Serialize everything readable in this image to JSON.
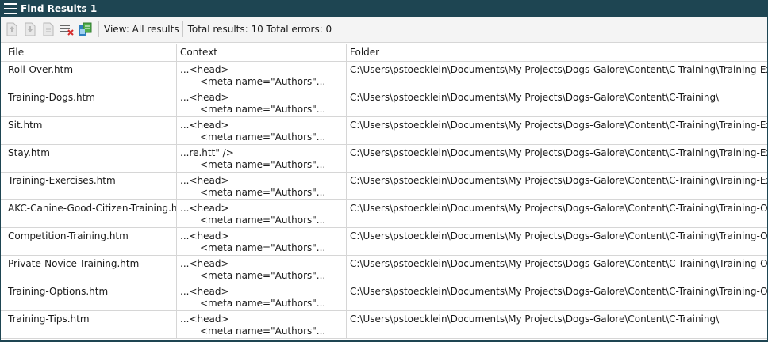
{
  "panel": {
    "title": "Find Results 1"
  },
  "toolbar": {
    "view_label": "View: All results",
    "totals_label": "Total results: 10 Total errors: 0",
    "buttons": [
      "previous-result-icon",
      "next-result-icon",
      "open-file-icon",
      "clear-results-icon",
      "export-results-icon"
    ]
  },
  "columns": {
    "file": "File",
    "context": "Context",
    "folder": "Folder"
  },
  "rows": [
    {
      "file": "Roll-Over.htm",
      "context1": "...<head>",
      "context2": "<meta name=\"Authors\"...",
      "folder": "C:\\Users\\pstoecklein\\Documents\\My Projects\\Dogs-Galore\\Content\\C-Training\\Training-Exercises\\"
    },
    {
      "file": "Training-Dogs.htm",
      "context1": "...<head>",
      "context2": "<meta name=\"Authors\"...",
      "folder": "C:\\Users\\pstoecklein\\Documents\\My Projects\\Dogs-Galore\\Content\\C-Training\\"
    },
    {
      "file": "Sit.htm",
      "context1": "...<head>",
      "context2": "<meta name=\"Authors\"...",
      "folder": "C:\\Users\\pstoecklein\\Documents\\My Projects\\Dogs-Galore\\Content\\C-Training\\Training-Exercises\\"
    },
    {
      "file": "Stay.htm",
      "context1": "...re.htt\" />",
      "context2": "<meta name=\"Authors\"...",
      "folder": "C:\\Users\\pstoecklein\\Documents\\My Projects\\Dogs-Galore\\Content\\C-Training\\Training-Exercises\\"
    },
    {
      "file": "Training-Exercises.htm",
      "context1": "...<head>",
      "context2": "<meta name=\"Authors\"...",
      "folder": "C:\\Users\\pstoecklein\\Documents\\My Projects\\Dogs-Galore\\Content\\C-Training\\Training-Exercises\\"
    },
    {
      "file": "AKC-Canine-Good-Citizen-Training.htm",
      "context1": "...<head>",
      "context2": "<meta name=\"Authors\"...",
      "folder": "C:\\Users\\pstoecklein\\Documents\\My Projects\\Dogs-Galore\\Content\\C-Training\\Training-Options\\"
    },
    {
      "file": "Competition-Training.htm",
      "context1": "...<head>",
      "context2": "<meta name=\"Authors\"...",
      "folder": "C:\\Users\\pstoecklein\\Documents\\My Projects\\Dogs-Galore\\Content\\C-Training\\Training-Options\\"
    },
    {
      "file": "Private-Novice-Training.htm",
      "context1": "...<head>",
      "context2": "<meta name=\"Authors\"...",
      "folder": "C:\\Users\\pstoecklein\\Documents\\My Projects\\Dogs-Galore\\Content\\C-Training\\Training-Options\\"
    },
    {
      "file": "Training-Options.htm",
      "context1": "...<head>",
      "context2": "<meta name=\"Authors\"...",
      "folder": "C:\\Users\\pstoecklein\\Documents\\My Projects\\Dogs-Galore\\Content\\C-Training\\Training-Options\\"
    },
    {
      "file": "Training-Tips.htm",
      "context1": "...<head>",
      "context2": "<meta name=\"Authors\"...",
      "folder": "C:\\Users\\pstoecklein\\Documents\\My Projects\\Dogs-Galore\\Content\\C-Training\\"
    }
  ]
}
